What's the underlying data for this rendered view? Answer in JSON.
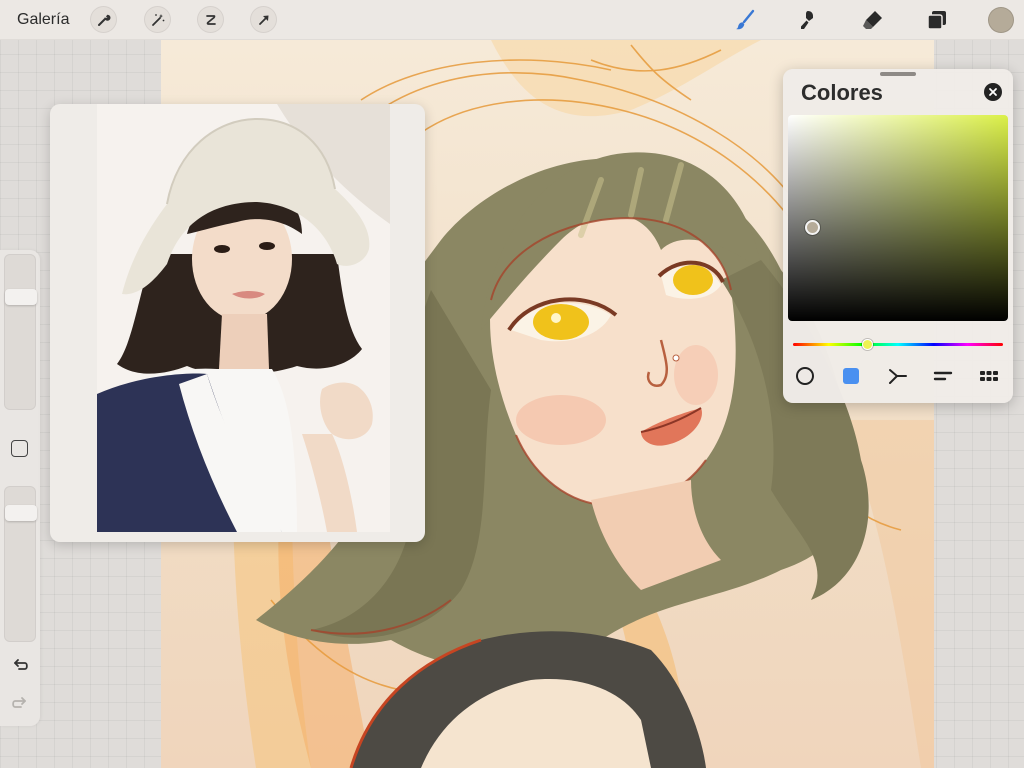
{
  "topbar": {
    "gallery_label": "Galería",
    "left_tools": [
      {
        "name": "wrench-icon"
      },
      {
        "name": "magic-wand-icon"
      },
      {
        "name": "selection-icon"
      },
      {
        "name": "arrow-cursor-icon"
      }
    ],
    "right_tools": [
      {
        "name": "brush-icon",
        "active": true
      },
      {
        "name": "smudge-icon"
      },
      {
        "name": "eraser-icon"
      },
      {
        "name": "layers-icon"
      }
    ],
    "current_color": "#b5ab99",
    "accent_color": "#3a78d4"
  },
  "sidebar": {
    "brush_size_level": 0.76,
    "opacity_level": 0.87,
    "icons": [
      "modify-square-icon",
      "undo-icon",
      "redo-icon"
    ]
  },
  "reference_window": {
    "visible": true
  },
  "colors_panel": {
    "title": "Colores",
    "selected_color": "#b5ab99",
    "hue_gradient_end": "#dbf048",
    "hue_position": 0.35,
    "modes": [
      {
        "name": "disc-mode-icon",
        "active": false
      },
      {
        "name": "classic-mode-icon",
        "active": true
      },
      {
        "name": "harmony-mode-icon",
        "active": false
      },
      {
        "name": "value-mode-icon",
        "active": false
      },
      {
        "name": "palettes-mode-icon",
        "active": false
      }
    ]
  }
}
